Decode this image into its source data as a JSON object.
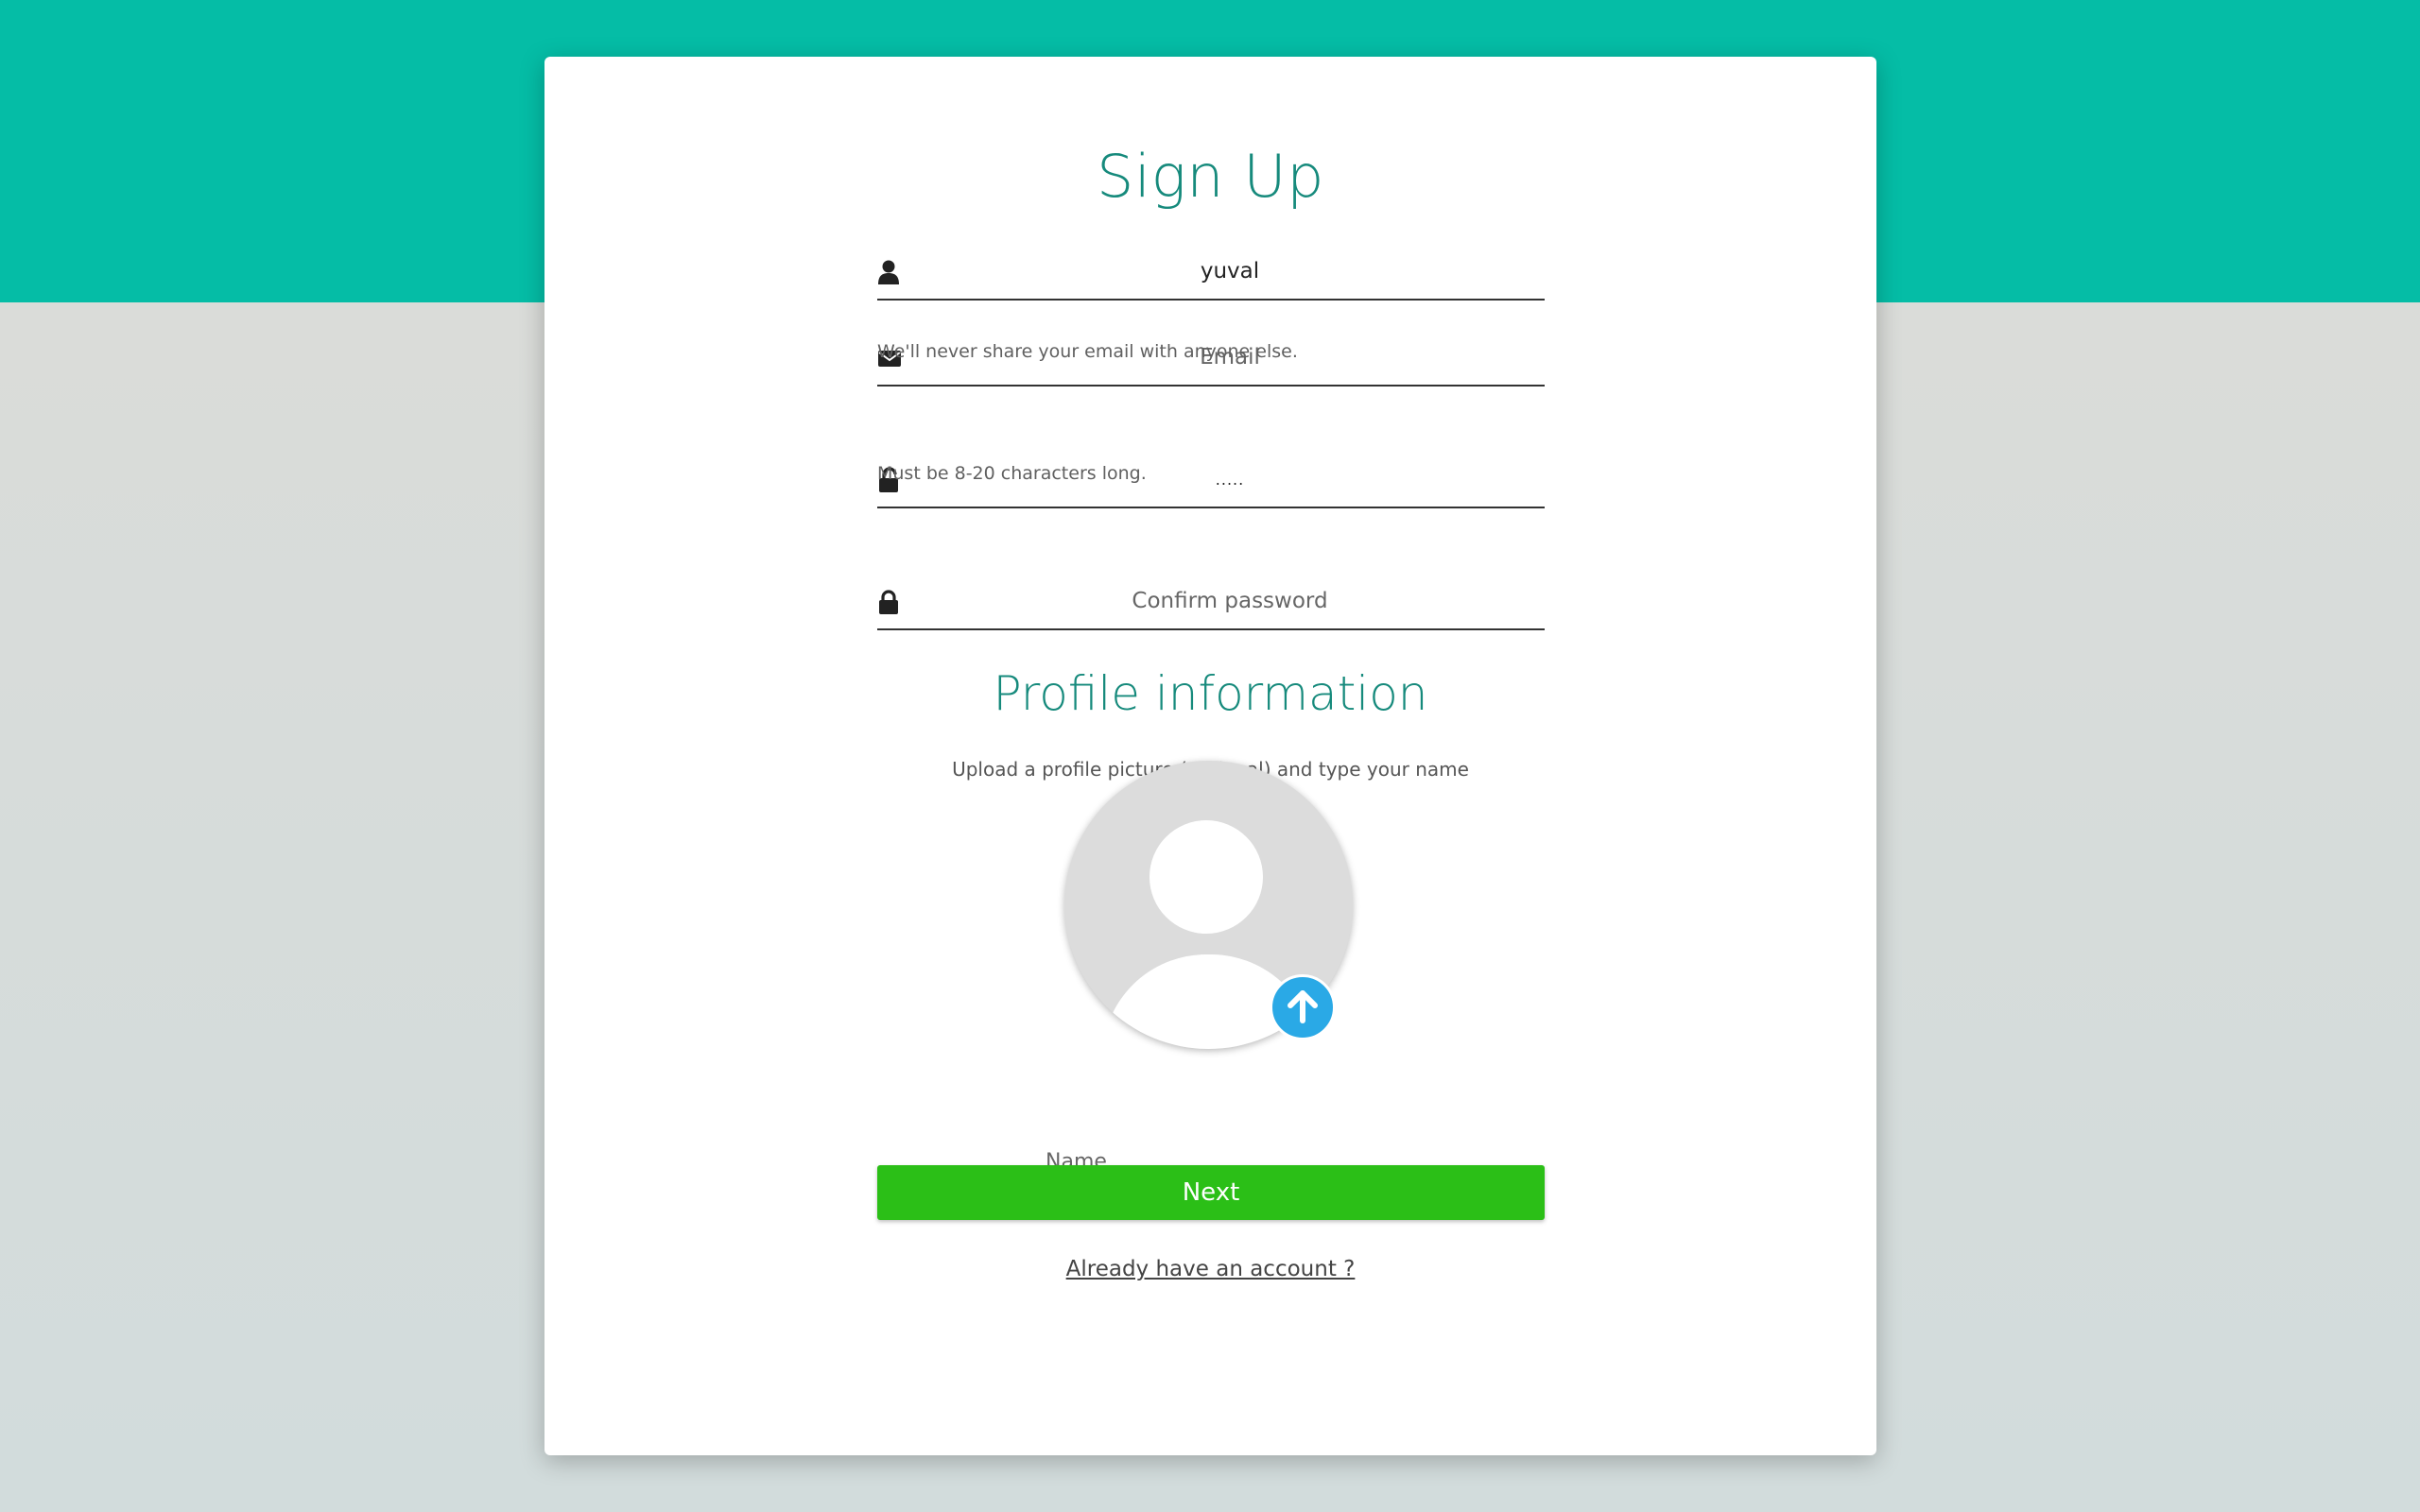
{
  "signup": {
    "title": "Sign Up",
    "username_value": "yuval",
    "email_placeholder": "Email",
    "email_help": "We'll never share your email with anyone else.",
    "password_value": ".....",
    "password_help": "Must be 8-20 characters long.",
    "confirm_placeholder": "Confirm password"
  },
  "profile": {
    "title": "Profile information",
    "subtitle": "Upload a profile picture (optional) and type your name",
    "name_placeholder": "Name"
  },
  "actions": {
    "next_label": "Next",
    "login_link": "Already have an account ?"
  },
  "colors": {
    "top_band": "#05bda6",
    "heading": "#168a7c",
    "next_button": "#2bbf17",
    "upload_button": "#2aa9e6"
  },
  "icons": {
    "username": "user-icon",
    "email": "envelope-icon",
    "password": "unlock-icon",
    "confirm": "lock-icon",
    "upload": "arrow-up-icon"
  }
}
